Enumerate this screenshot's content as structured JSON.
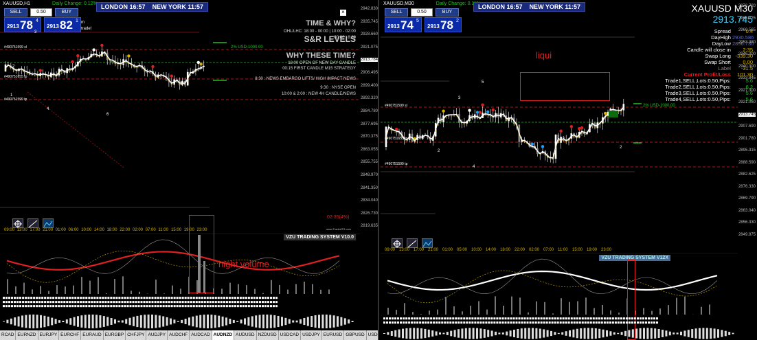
{
  "left": {
    "title_symbol": "XAUUSD,H1",
    "daily_change_label": "Daily Change: 0.12%",
    "london_label": "LONDON",
    "london_time": "16:57",
    "newyork_label": "NEW YORK",
    "newyork_time": "11:57",
    "sell_label": "SELL",
    "buy_label": "BUY",
    "lot": "0.50",
    "bid_small": "2913",
    "bid_big": "78",
    "bid_sup": "4",
    "ask_small": "2913",
    "ask_big": "82",
    "ask_sup": "1",
    "price_axis": [
      "2942.830",
      "2935.745",
      "2928.660",
      "2921.075",
      "2913.784",
      "2906.495",
      "2899.400",
      "2892.320",
      "2884.780",
      "2877.695",
      "2870.375",
      "2863.055",
      "2855.755",
      "2848.970",
      "2841.350",
      "2834.040",
      "2826.730",
      "2819.635"
    ],
    "sr": {
      "time_why": "TIME & WHY?",
      "ohl": "OHL/LHC: 18:00 - 00:00 | 10:00 - 02:00",
      "session": "00:00 | 8:30",
      "levels": "S&R LEVELS",
      "why_times": "WHY THESE TIME?",
      "l1": "18:00 OPEN OF NEW DAY CANDLE",
      "l2": "00:15 FIRST CANDLE M15 STRATEGY",
      "l3": "8:30 : NEWS EMBARGO LIFTS/ HIGH IMPACT NEWS",
      "l4": "9:30 : NYSE OPEN",
      "l5": "10:00 & 2:00 : NEW 4H CANDLE/NEWS",
      "usd_label": "2% USD-1000.00",
      "trade_hint": "trade!",
      "domain_hint": "m",
      "brand": "www.TradeATS.com"
    },
    "order_tags": [
      "#490751599 sl",
      "#490751655 tp",
      "#490751599 tp"
    ],
    "candle_counts": [
      "1",
      "2",
      "3",
      "4",
      "6"
    ],
    "percent": "02:35(4%)",
    "time_axis": [
      "09:00",
      "13:00",
      "17:00",
      "21:00",
      "01:00",
      "06:00",
      "10:00",
      "14:00",
      "18:00",
      "22:00",
      "02:00",
      "07:00",
      "11:00",
      "15:00",
      "19:00",
      "23:00"
    ],
    "indicator_label": "VZU TRADING SYSTEM V10.0",
    "annotation": "hight volume",
    "symbols": [
      "RCAD",
      "EURNZD",
      "EURJPY",
      "EURCHF",
      "EURAUD",
      "EURGBP",
      "CHFJPY",
      "AUDJPY",
      "AUDCHF",
      "AUDCAD",
      "AUDNZD",
      "AUDUSD",
      "NZDUSD",
      "USDCAD",
      "USDJPY",
      "EURUSD",
      "GBPUSD",
      "USDCHF"
    ],
    "active_symbol": "AUDNZD"
  },
  "right": {
    "title_symbol": "XAUUSD,M30",
    "daily_change_label": "Daily Change: 0.11%",
    "london_label": "LONDON",
    "london_time": "16:57",
    "newyork_label": "NEW YORK",
    "newyork_time": "11:57",
    "sell_label": "SELL",
    "buy_label": "BUY",
    "lot": "0.50",
    "bid_small": "2913",
    "bid_big": "74",
    "bid_sup": "5",
    "ask_small": "2913",
    "ask_big": "78",
    "ask_sup": "2",
    "symbol_title": "XAUUSD M30",
    "price": "2913.745",
    "info": [
      {
        "k": "Spread",
        "v": "0.4"
      },
      {
        "k": "DayHigh",
        "v": "2930.586"
      },
      {
        "k": "DayLow",
        "v": "2896.730"
      },
      {
        "k": "Candle will close in",
        "v": "2:35"
      },
      {
        "k": "Swap Long",
        "v": "-339.30"
      },
      {
        "k": "Swap Short",
        "v": "0.00"
      },
      {
        "k": "Label",
        "v": "-31.5"
      }
    ],
    "profit_label": "Current Profit/Loss",
    "profit_value": "101.30",
    "trades": [
      {
        "k": "Trade1,SELL,Lots:0.50,Pips:",
        "v": "5.6"
      },
      {
        "k": "Trade2,SELL,Lots:0.50,Pips:",
        "v": "6.2"
      },
      {
        "k": "Trade3,SELL,Lots:0.50,Pips:",
        "v": "5.6"
      },
      {
        "k": "Trade4,SELL,Lots:0.50,Pips:",
        "v": "5.6"
      }
    ],
    "price_axis": [
      "2972.720",
      "2966.025",
      "2960.565",
      "2953.380",
      "2946.000",
      "2940.300",
      "2933.845",
      "2927.300",
      "2921.050",
      "2913.745",
      "2907.690",
      "2901.780",
      "2895.315",
      "2888.590",
      "2882.625",
      "2876.330",
      "2869.790",
      "2863.040",
      "2856.330",
      "2849.875"
    ],
    "usd_label": "2% USD-1000.00",
    "order_tags": [
      "#490751599 sl",
      "#490751655 tp",
      "#490751599 tp"
    ],
    "candle_counts": [
      "5",
      "3",
      "2",
      "4",
      "2"
    ],
    "annotation": "liqui",
    "time_axis": [
      "09:00",
      "13:00",
      "17:00",
      "21:00",
      "01:00",
      "05:00",
      "10:00",
      "14:00",
      "18:00",
      "22:00",
      "02:00",
      "07:00",
      "11:00",
      "15:00",
      "19:00",
      "23:00"
    ],
    "indicator_label": "VZU TRADING SYSTEM V12X"
  },
  "colors": {
    "red": "#e02020",
    "yellow": "#d4b400",
    "blue": "#1f3c88",
    "green": "#22c022"
  }
}
